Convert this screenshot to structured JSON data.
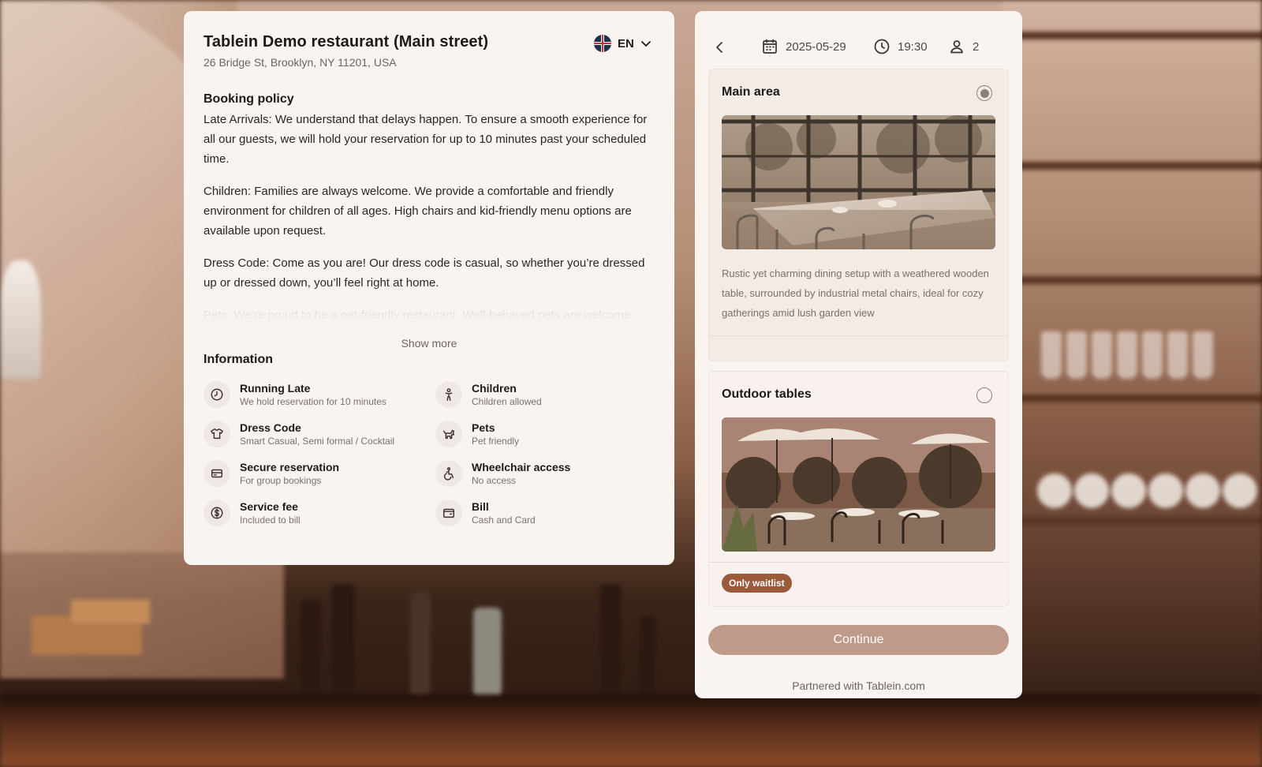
{
  "colors": {
    "accent": "#bf9a8b",
    "badge": "#9b5a3a",
    "card": "#faf4f1"
  },
  "restaurant": {
    "name": "Tablein Demo restaurant (Main street)",
    "address": "26 Bridge St, Brooklyn, NY 11201, USA",
    "language": "EN"
  },
  "policy": {
    "title": "Booking policy",
    "paragraphs": [
      "Late Arrivals: We understand that delays happen. To ensure a smooth experience for all our guests, we will hold your reservation for up to 10 minutes past your scheduled time.",
      "Children: Families are always welcome. We provide a comfortable and friendly environment for children of all ages. High chairs and kid-friendly menu options are available upon request.",
      "Dress Code: Come as you are! Our dress code is casual, so whether you’re dressed up or dressed down, you’ll feel right at home.",
      "Pets: We’re proud to be a pet-friendly restaurant. Well-behaved pets are welcome"
    ],
    "show_more": "Show more"
  },
  "information": {
    "title": "Information",
    "items": [
      {
        "label": "Running Late",
        "sub": "We hold reservation for 10 minutes",
        "icon": "clock-late-icon"
      },
      {
        "label": "Children",
        "sub": "Children allowed",
        "icon": "child-icon"
      },
      {
        "label": "Dress Code",
        "sub": "Smart Casual, Semi formal / Cocktail",
        "icon": "shirt-icon"
      },
      {
        "label": "Pets",
        "sub": "Pet friendly",
        "icon": "dog-icon"
      },
      {
        "label": "Secure reservation",
        "sub": "For group bookings",
        "icon": "credit-card-icon"
      },
      {
        "label": "Wheelchair access",
        "sub": "No access",
        "icon": "wheelchair-icon"
      },
      {
        "label": "Service fee",
        "sub": "Included to bill",
        "icon": "dollar-icon"
      },
      {
        "label": "Bill",
        "sub": "Cash and Card",
        "icon": "wallet-icon"
      }
    ]
  },
  "booking": {
    "date": "2025-05-29",
    "time": "19:30",
    "guests": "2",
    "areas": [
      {
        "title": "Main area",
        "selected": true,
        "description": "Rustic yet charming dining setup with a weathered wooden table, surrounded by industrial metal chairs, ideal for cozy gatherings amid lush garden view"
      },
      {
        "title": "Outdoor tables",
        "selected": false,
        "badge": "Only waitlist"
      }
    ],
    "continue_label": "Continue",
    "partner_text": "Partnered with Tablein.com"
  }
}
